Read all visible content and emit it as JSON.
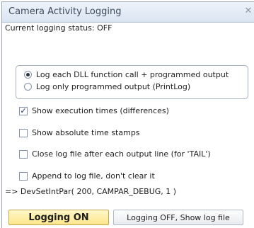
{
  "window": {
    "title": "Camera Activity Logging"
  },
  "status": {
    "label": "Current logging status:",
    "value": "OFF"
  },
  "options": {
    "radio": [
      {
        "label": "Log each DLL function call + programmed output",
        "checked": true
      },
      {
        "label": "Log only programmed output (PrintLog)",
        "checked": false
      }
    ],
    "checkboxes": [
      {
        "label": "Show execution times (differences)",
        "checked": true
      },
      {
        "label": "Show absolute time stamps",
        "checked": false
      },
      {
        "label": "Close log file after each output line (for 'TAIL')",
        "checked": false
      },
      {
        "label": "Append to log file, don't clear it",
        "checked": false
      }
    ]
  },
  "command": "=> DevSetIntPar( 200, CAMPAR_DEBUG, 1 )",
  "buttons": {
    "on": "Logging ON",
    "off": "Logging OFF, Show log file"
  },
  "icons": {
    "close": "close-icon",
    "checkmark": "checkmark-icon"
  },
  "colors": {
    "accent_button": "#fde68b",
    "title_text": "#3b4a5c"
  }
}
